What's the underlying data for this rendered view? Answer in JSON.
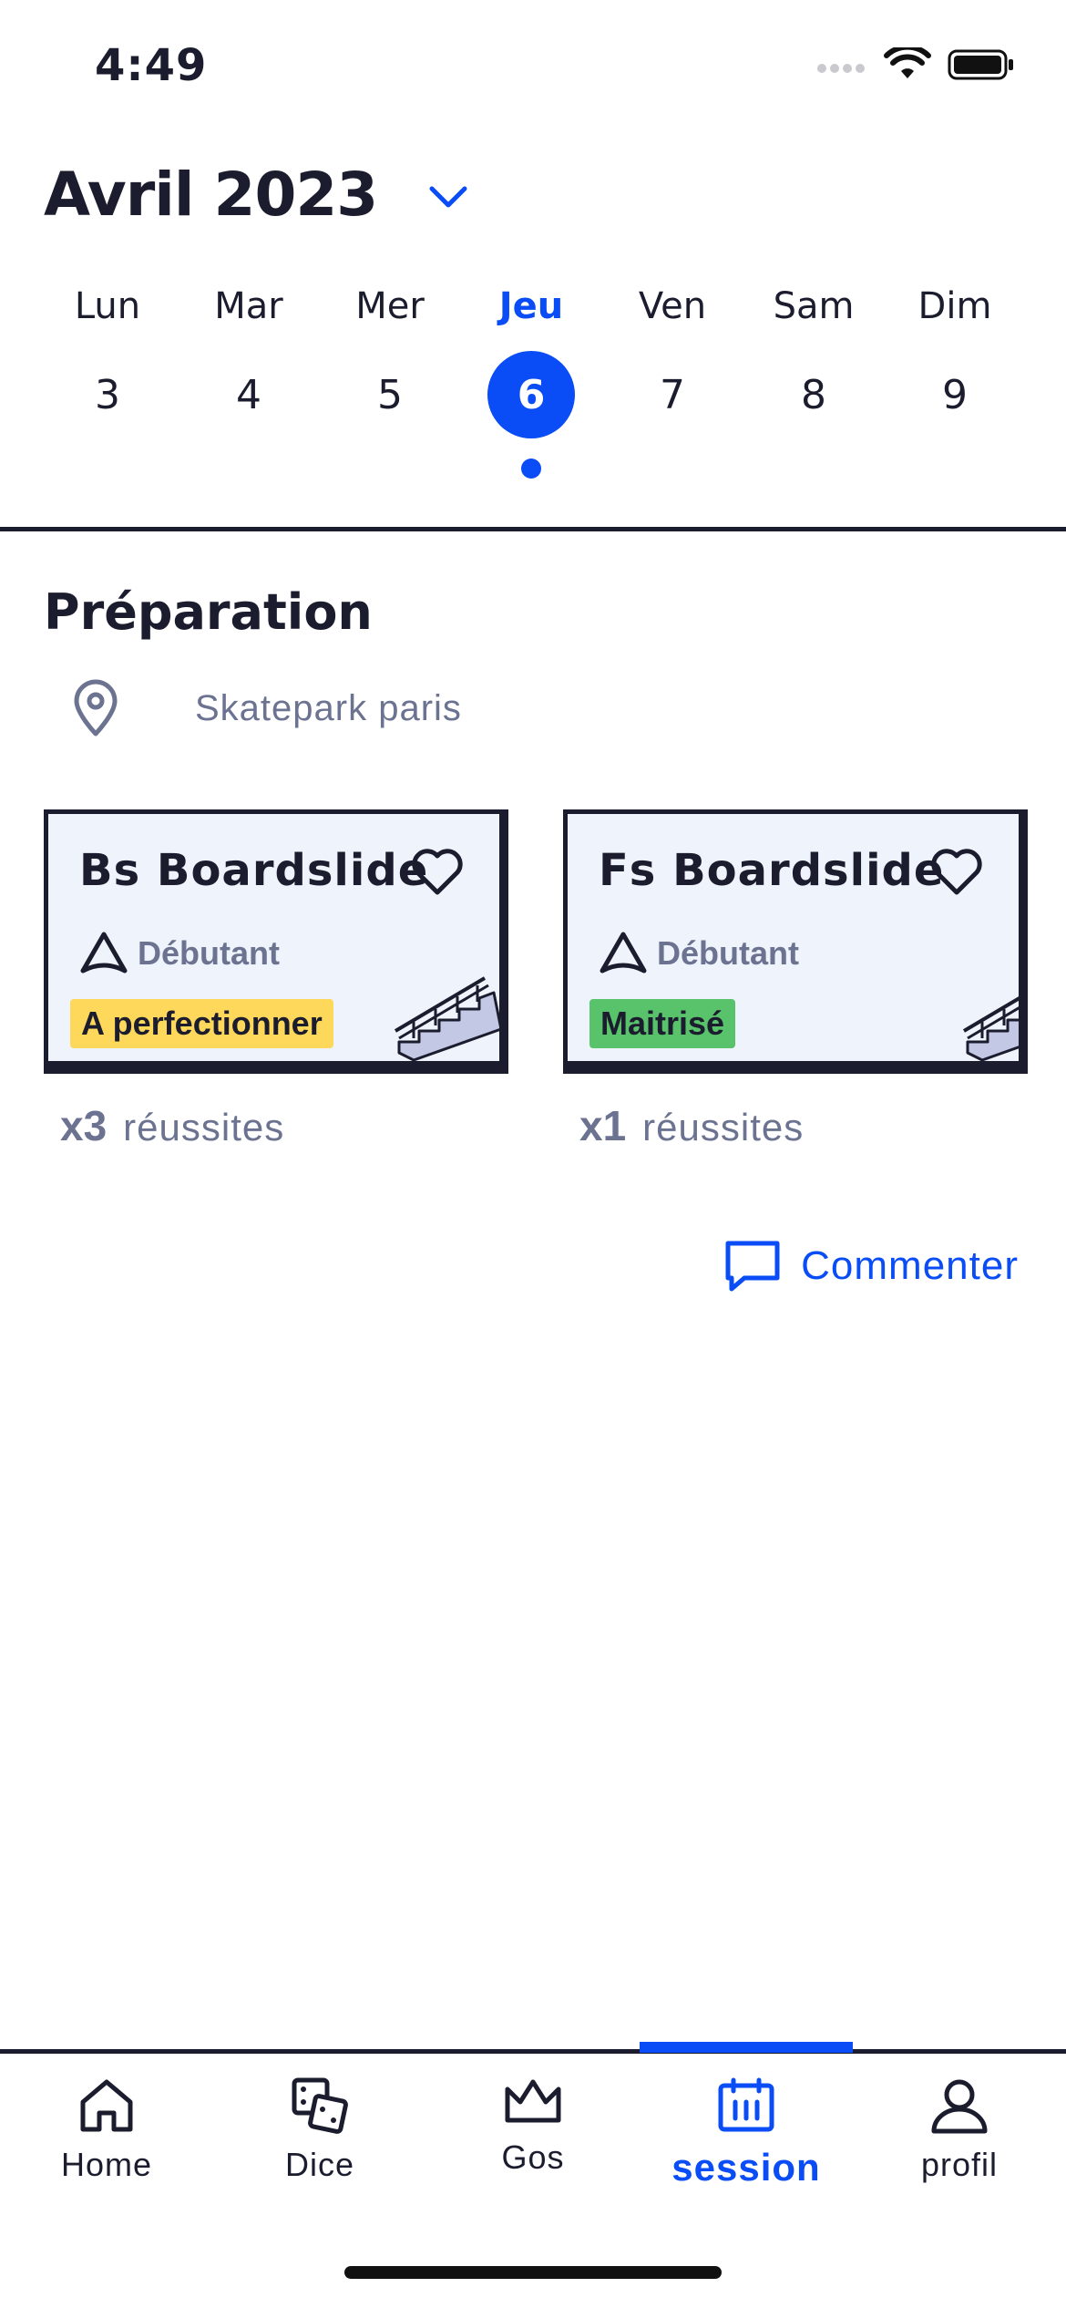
{
  "status_bar": {
    "time": "4:49"
  },
  "header": {
    "month_title": "Avril 2023"
  },
  "week": [
    {
      "name": "Lun",
      "num": "3",
      "selected": false
    },
    {
      "name": "Mar",
      "num": "4",
      "selected": false
    },
    {
      "name": "Mer",
      "num": "5",
      "selected": false
    },
    {
      "name": "Jeu",
      "num": "6",
      "selected": true
    },
    {
      "name": "Ven",
      "num": "7",
      "selected": false
    },
    {
      "name": "Sam",
      "num": "8",
      "selected": false
    },
    {
      "name": "Dim",
      "num": "9",
      "selected": false
    }
  ],
  "section": {
    "title": "Préparation",
    "location": "Skatepark paris"
  },
  "cards": [
    {
      "title": "Bs Boardslide",
      "level": "Débutant",
      "status": "A perfectionner",
      "count": "x3",
      "count_label": "réussites"
    },
    {
      "title": "Fs Boardslide",
      "level": "Débutant",
      "status": "Maitrisé",
      "count": "x1",
      "count_label": "réussites"
    }
  ],
  "comment": {
    "label": "Commenter"
  },
  "tabs": [
    {
      "label": "Home",
      "icon": "home-icon"
    },
    {
      "label": "Dice",
      "icon": "dice-icon"
    },
    {
      "label": "Gos",
      "icon": "crown-icon"
    },
    {
      "label": "session",
      "icon": "calendar-icon",
      "active": true
    },
    {
      "label": "profil",
      "icon": "user-icon"
    }
  ],
  "colors": {
    "accent": "#0a4cf5",
    "text": "#1b1c2e",
    "muted": "#6b7391",
    "card_bg": "#eff3fc",
    "badge_to_improve": "#fdd85a",
    "badge_mastered": "#58c36a"
  }
}
